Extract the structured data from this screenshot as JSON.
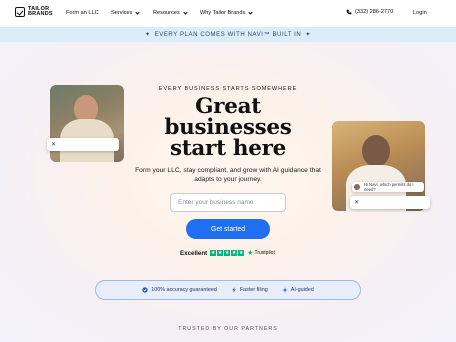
{
  "brand": {
    "line1": "TAILOR",
    "line2": "BRANDS"
  },
  "nav": {
    "form_llc": "Form an LLC",
    "services": "Services",
    "resources": "Resources",
    "why": "Why Tailor Brands",
    "phone": "(332) 286-2770",
    "login": "Login"
  },
  "banner": {
    "text": "EVERY PLAN COMES WITH NAVI™ BUILT IN"
  },
  "hero": {
    "eyebrow": "EVERY BUSINESS STARTS SOMEWHERE",
    "headline_line1": "Great",
    "headline_line2": "businesses",
    "headline_line3": "start here",
    "subtitle": "Form your LLC, stay compliant, and grow with AI guidance that adapts to your journey.",
    "input_placeholder": "Enter your business name",
    "cta_label": "Get started"
  },
  "trustpilot": {
    "rating_word": "Excellent",
    "brand": "Trustpilot",
    "stars": 5
  },
  "features": [
    {
      "label": "100% accuracy guaranteed",
      "icon": "check-badge-icon"
    },
    {
      "label": "Faster filing",
      "icon": "lightning-icon"
    },
    {
      "label": "AI-guided",
      "icon": "sparkle-icon"
    }
  ],
  "partners": {
    "heading": "TRUSTED BY OUR PARTNERS"
  },
  "chat_right": {
    "question": "Hi Navi, which permits do I need?"
  },
  "colors": {
    "accent": "#1f6ff2",
    "banner_bg": "#dcecf8",
    "trustpilot": "#00b67a"
  }
}
